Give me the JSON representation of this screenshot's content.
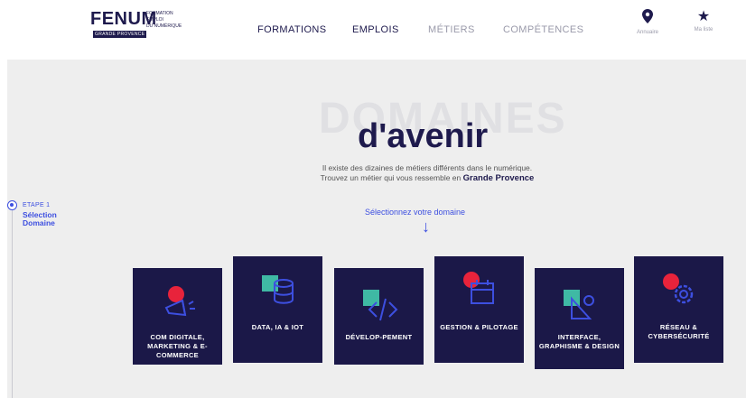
{
  "header": {
    "logo": {
      "name": "FENUM",
      "tag": "GRANDE PROVENCE",
      "subtitle_lines": [
        "FORMATION",
        "EMPLOI",
        "DU NUMÉRIQUE"
      ]
    },
    "nav": [
      {
        "label": "FORMATIONS"
      },
      {
        "label": "EMPLOIS"
      },
      {
        "label": "MÉTIERS"
      },
      {
        "label": "COMPÉTENCES"
      }
    ],
    "right_icons": [
      {
        "icon": "map-pin-icon",
        "label": "Annuaire"
      },
      {
        "icon": "star-icon",
        "label": "Ma liste"
      }
    ]
  },
  "hero": {
    "watermark": "DOMAINES",
    "title": "d'avenir",
    "intro_line1": "Il existe des dizaines de métiers différents dans le numérique.",
    "intro_line2": "Trouvez un métier qui vous ressemble en",
    "intro_highlight": "Grande Provence",
    "select_label": "Sélectionnez votre domaine"
  },
  "stepper": {
    "step": "ETAPE 1",
    "title": "Sélection Domaine"
  },
  "domains": [
    {
      "label": "COM DIGITALE, MARKETING & E-COMMERCE",
      "icon": "megaphone-icon"
    },
    {
      "label": "DATA, IA & IOT",
      "icon": "database-icon"
    },
    {
      "label": "DÉVELOP-PEMENT",
      "icon": "code-icon"
    },
    {
      "label": "GESTION & PILOTAGE",
      "icon": "calendar-icon"
    },
    {
      "label": "INTERFACE, GRAPHISME & DESIGN",
      "icon": "shapes-icon"
    },
    {
      "label": "RÉSEAU & CYBERSÉCURITÉ",
      "icon": "gear-icon"
    }
  ],
  "colors": {
    "navy": "#1b1848",
    "accent_blue": "#3d4fe0",
    "red": "#e8233b",
    "teal": "#3fb9a4",
    "background": "#eeeeee"
  }
}
